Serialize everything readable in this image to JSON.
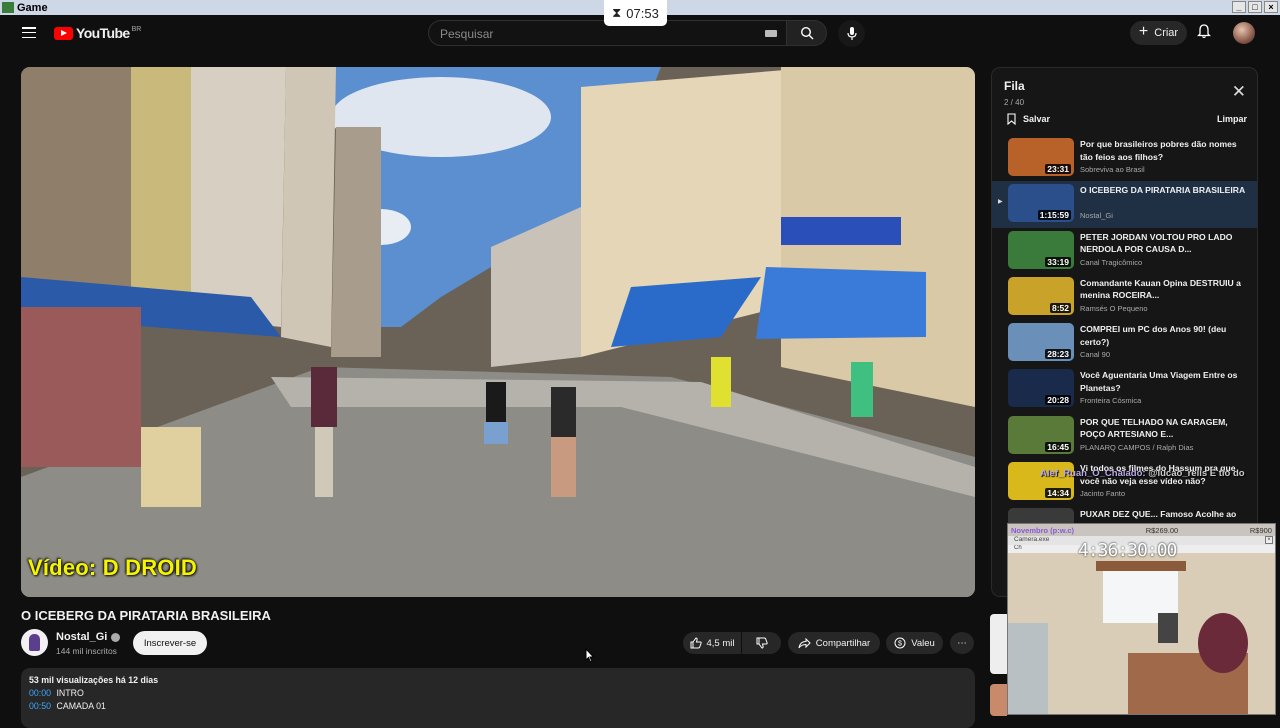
{
  "window": {
    "title": "Game"
  },
  "timer": {
    "value": "07:53"
  },
  "header": {
    "logo_text": "YouTube",
    "region": "BR",
    "search_placeholder": "Pesquisar",
    "create_label": "Criar"
  },
  "video": {
    "watermark": "Vídeo: D DROID",
    "title": "O ICEBERG DA PIRATARIA BRASILEIRA",
    "channel": "Nostal_Gi",
    "subscribers": "144 mil inscritos",
    "subscribe_label": "Inscrever-se",
    "likes": "4,5 mil",
    "share_label": "Compartilhar",
    "thanks_label": "Valeu"
  },
  "description": {
    "meta": "53 mil visualizações  há 12 dias",
    "chapters": [
      {
        "time": "00:00",
        "label": "INTRO"
      },
      {
        "time": "00:50",
        "label": "CAMADA 01"
      }
    ]
  },
  "queue": {
    "title": "Fila",
    "count": "2 / 40",
    "save_label": "Salvar",
    "clear_label": "Limpar",
    "items": [
      {
        "title": "Por que brasileiros pobres dão nomes tão feios aos filhos?",
        "channel": "Sobrevivа ao Brasil",
        "duration": "23:31",
        "color": "#b8622a"
      },
      {
        "title": "O ICEBERG DA PIRATARIA BRASILEIRA",
        "channel": "Nostal_Gi",
        "duration": "1:15:59",
        "color": "#2a4f8a"
      },
      {
        "title": "PETER JORDAN VOLTOU PRO LADO NERDOLA POR CAUSA D...",
        "channel": "Canal Tragicômico",
        "duration": "33:19",
        "color": "#3a7a3a"
      },
      {
        "title": "Comandante Kauan Opina DESTRUIU a menina ROCEIRA...",
        "channel": "Ramsés O Pequeno",
        "duration": "8:52",
        "color": "#c9a22a"
      },
      {
        "title": "COMPREI um PC dos Anos 90! (deu certo?)",
        "channel": "Canal 90",
        "duration": "28:23",
        "color": "#6a8fb8"
      },
      {
        "title": "Você Aguentaria Uma Viagem Entre os Planetas?",
        "channel": "Fronteira Cósmica",
        "duration": "20:28",
        "color": "#1a2a4a"
      },
      {
        "title": "POR QUE TELHADO NA GARAGEM, POÇO ARTESIANO E...",
        "channel": "PLANARQ CAMPOS / Ralph Dias",
        "duration": "16:45",
        "color": "#5a7a3a"
      },
      {
        "title": "Vi todos os filmes do Hassum pra que você não veja esse vídeo não?",
        "channel": "Jacinto Fanto",
        "duration": "14:34",
        "color": "#d8b81a"
      },
      {
        "title": "PUXAR DEZ QUE... Famoso Acolhe ao Ser Pegado",
        "channel": "",
        "duration": "",
        "color": "#3a3a3a"
      }
    ]
  },
  "overlay": {
    "chat_name": "Alef_Ruan_O_Chalado",
    "chat_msg": ": @lucao_reiis E tio do",
    "cam_user": "Novembro (p:w.c)",
    "cam_price1": "R$269.00",
    "cam_price2": "R$900",
    "cam_window_title": "Camera.exe",
    "cam_menu": "Ch",
    "clock": "4:36:30:00"
  }
}
